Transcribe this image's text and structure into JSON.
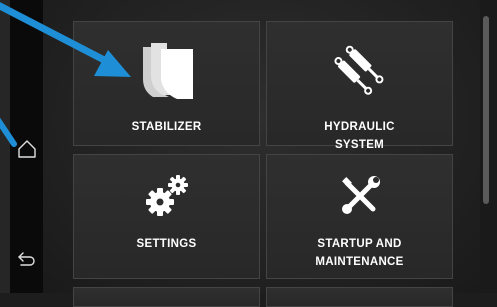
{
  "tiles": [
    {
      "label": "STABILIZER",
      "icon": "stabilizer-icon"
    },
    {
      "label_line1": "HYDRAULIC",
      "label_line2": "SYSTEM",
      "icon": "hydraulic-cylinder-icon"
    },
    {
      "label": "SETTINGS",
      "icon": "gears-icon"
    },
    {
      "label_line1": "STARTUP AND",
      "label_line2": "MAINTENANCE",
      "icon": "wrench-screwdriver-icon"
    }
  ],
  "nav": {
    "home_icon": "home-icon",
    "back_icon": "back-icon"
  },
  "colors": {
    "annotation_arrow": "#1e8fd6",
    "tile_bg": "#2c2c2c",
    "rail_bg": "#0a0a0a"
  }
}
